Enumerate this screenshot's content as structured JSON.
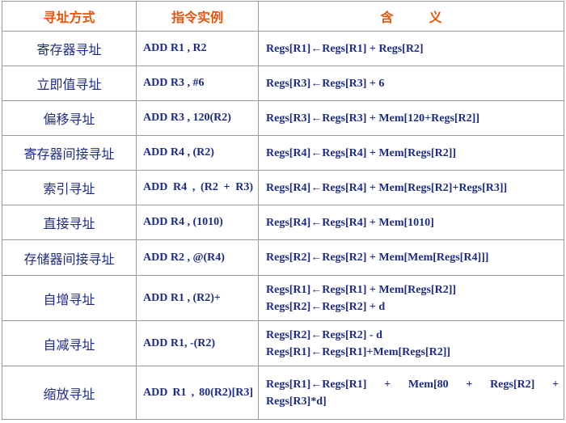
{
  "table": {
    "headers": {
      "mode": "寻址方式",
      "example": "指令实例",
      "meaning_left": "含",
      "meaning_right": "义"
    },
    "rows": [
      {
        "mode": "寄存器寻址",
        "example": "ADD R1 , R2",
        "meaning": [
          "Regs[R1]←Regs[R1] + Regs[R2]"
        ]
      },
      {
        "mode": "立即值寻址",
        "example": "ADD R3 , #6",
        "meaning": [
          "Regs[R3]←Regs[R3] + 6"
        ]
      },
      {
        "mode": "偏移寻址",
        "example": "ADD R3 , 120(R2)",
        "meaning": [
          "Regs[R3]←Regs[R3] + Mem[120+Regs[R2]]"
        ]
      },
      {
        "mode": "寄存器间接寻址",
        "example": "ADD  R4 , (R2)",
        "meaning": [
          "Regs[R4]←Regs[R4] + Mem[Regs[R2]]"
        ]
      },
      {
        "mode": "索引寻址",
        "example": "ADD  R4 , (R2 + R3)",
        "meaning": [
          "Regs[R4]←Regs[R4] + Mem[Regs[R2]+Regs[R3]]"
        ]
      },
      {
        "mode": "直接寻址",
        "example": "ADD R4 , (1010)",
        "meaning": [
          "Regs[R4]←Regs[R4] + Mem[1010]"
        ]
      },
      {
        "mode": "存储器间接寻址",
        "example": "ADD R2 , @(R4)",
        "meaning": [
          "Regs[R2]←Regs[R2] + Mem[Mem[Regs[R4]]]"
        ]
      },
      {
        "mode": "自增寻址",
        "example": "ADD R1 , (R2)+",
        "meaning": [
          "Regs[R1]←Regs[R1] + Mem[Regs[R2]]",
          "Regs[R2]←Regs[R2] + d"
        ]
      },
      {
        "mode": "自减寻址",
        "example": "ADD R1, -(R2)",
        "meaning": [
          "Regs[R2]←Regs[R2] - d",
          "Regs[R1]←Regs[R1]+Mem[Regs[R2]]"
        ]
      },
      {
        "mode": "缩放寻址",
        "example": "ADD R1 , 80(R2)[R3]",
        "meaning": [
          "Regs[R1]←Regs[R1]   +   Mem[80   +   Regs[R2]   +",
          "Regs[R3]*d]"
        ]
      }
    ]
  },
  "colors": {
    "header_text": "#e8550a",
    "body_text": "#1c2b86",
    "grid": "#9a9a9a"
  }
}
